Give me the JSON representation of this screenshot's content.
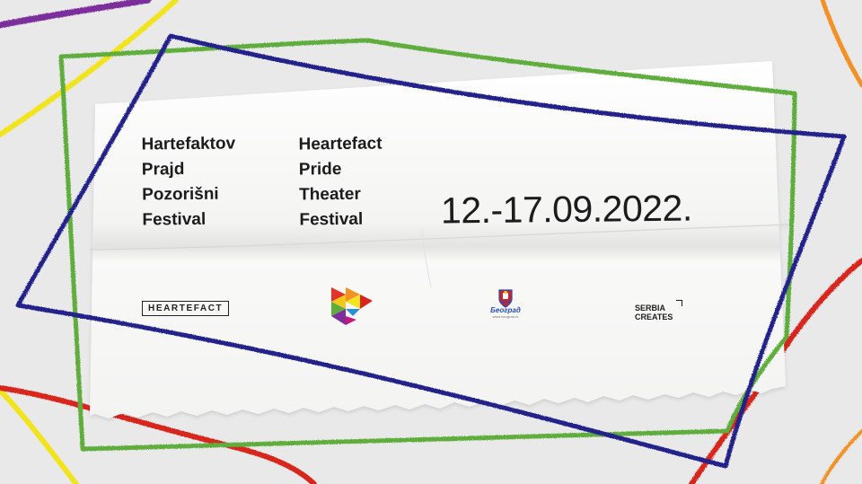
{
  "festival": {
    "title_sr": [
      "Hartefaktov",
      "Prajd",
      "Pozorišni",
      "Festival"
    ],
    "title_en": [
      "Heartefact",
      "Pride",
      "Theater",
      "Festival"
    ],
    "dates": "12.-17.09.2022."
  },
  "logos": {
    "heartefact": "HEARTEFACT",
    "beograd": "Београд",
    "beograd_url": "www.beograd.rs",
    "serbia_creates": [
      "SERBIA",
      "CREATES"
    ]
  },
  "colors": {
    "background": "#e9e9e9",
    "paper": "#f7f7f6",
    "crayon_blue": "#24238a",
    "crayon_green": "#5fae3c",
    "crayon_red": "#d8261f",
    "crayon_yellow": "#f2e41e",
    "crayon_purple": "#7c2f9c",
    "crayon_orange": "#f29226",
    "text": "#1c1c1c"
  }
}
